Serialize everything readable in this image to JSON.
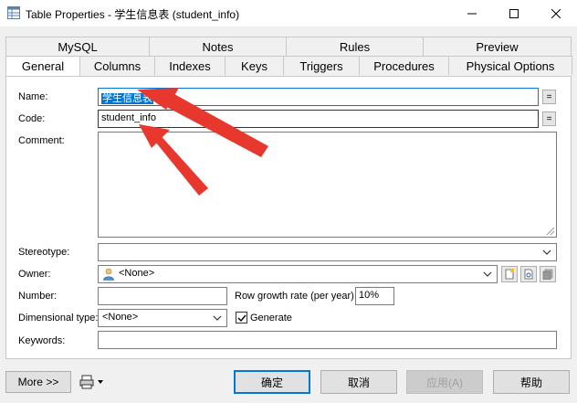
{
  "window": {
    "title": "Table Properties - 学生信息表 (student_info)",
    "controls": {
      "minimize": "—",
      "maximize": "☐",
      "close": "✕"
    }
  },
  "tabs": {
    "back_row": [
      "MySQL",
      "Notes",
      "Rules",
      "Preview"
    ],
    "front_row": [
      "General",
      "Columns",
      "Indexes",
      "Keys",
      "Triggers",
      "Procedures",
      "Physical Options"
    ],
    "active": "General"
  },
  "form": {
    "name_label": "Name:",
    "name_value": "学生信息表",
    "code_label": "Code:",
    "code_value": "student_info",
    "comment_label": "Comment:",
    "comment_value": "",
    "stereotype_label": "Stereotype:",
    "stereotype_value": "",
    "owner_label": "Owner:",
    "owner_value": "<None>",
    "number_label": "Number:",
    "number_value": "",
    "growth_label": "Row growth rate (per year):",
    "growth_value": "10%",
    "dimensional_label": "Dimensional type:",
    "dimensional_value": "<None>",
    "generate_label": "Generate",
    "generate_checked": true,
    "keywords_label": "Keywords:",
    "keywords_value": "",
    "eq_button": "="
  },
  "footer": {
    "more_label": "More >>",
    "ok_label": "确定",
    "cancel_label": "取消",
    "apply_label": "应用(A)",
    "help_label": "帮助"
  },
  "colors": {
    "accent": "#0078d7",
    "annotation_arrow": "#e8372d"
  }
}
